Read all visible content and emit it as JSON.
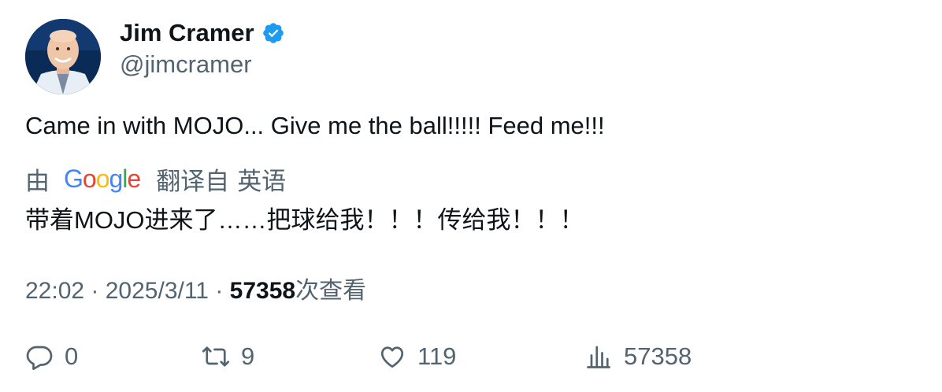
{
  "author": {
    "display_name": "Jim Cramer",
    "handle": "@jimcramer",
    "verified": true,
    "verified_color": "#1d9bf0"
  },
  "tweet": {
    "text": "Came in with MOJO... Give me the ball!!!!! Feed me!!!"
  },
  "translation": {
    "by_label": "由",
    "provider": "Google",
    "from_label": "翻译自",
    "language": "英语",
    "translated_text": "带着MOJO进来了……把球给我！！！传给我！！！"
  },
  "meta": {
    "time": "22:02",
    "separator1": " · ",
    "date": "2025/3/11",
    "separator2": " · ",
    "views_count": "57358",
    "views_label": "次查看"
  },
  "actions": {
    "reply_count": "0",
    "retweet_count": "9",
    "like_count": "119",
    "views_count": "57358"
  },
  "colors": {
    "text_primary": "#0f1419",
    "text_secondary": "#536471",
    "google_blue": "#4285f4",
    "google_red": "#ea4335",
    "google_yellow": "#fbbc05",
    "google_green": "#34a853"
  },
  "icons": {
    "reply": "reply-icon",
    "retweet": "retweet-icon",
    "like": "heart-icon",
    "views": "bar-chart-icon",
    "verified": "verified-badge-icon"
  }
}
